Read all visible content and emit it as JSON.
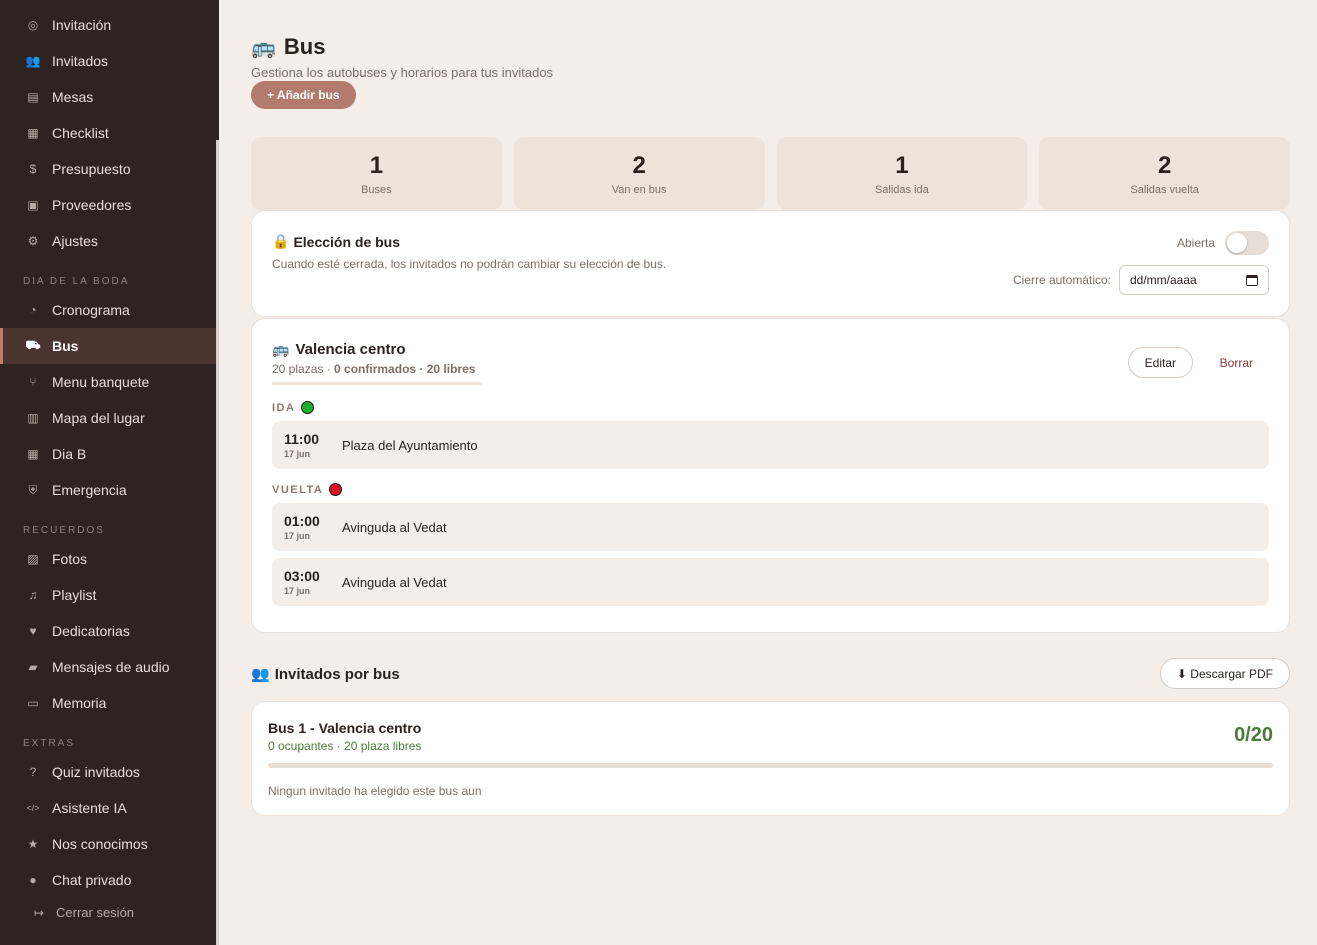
{
  "sidebar": {
    "items": [
      {
        "label": "Invitación",
        "icon": "globe-icon",
        "glyph": "◎"
      },
      {
        "label": "Invitados",
        "icon": "users-icon",
        "glyph": "👥"
      },
      {
        "label": "Mesas",
        "icon": "table-icon",
        "glyph": "▤"
      },
      {
        "label": "Checklist",
        "icon": "calendar-icon",
        "glyph": "▦"
      },
      {
        "label": "Presupuesto",
        "icon": "money-icon",
        "glyph": "$"
      },
      {
        "label": "Proveedores",
        "icon": "briefcase-icon",
        "glyph": "▣"
      },
      {
        "label": "Ajustes",
        "icon": "gear-icon",
        "glyph": "⚙"
      }
    ],
    "section_wedding": "DIA DE LA BODA",
    "wedding_items": [
      {
        "label": "Cronograma",
        "icon": "clock-icon",
        "glyph": "◔"
      },
      {
        "label": "Bus",
        "icon": "truck-icon",
        "glyph": "⛟"
      },
      {
        "label": "Menu banquete",
        "icon": "utensils-icon",
        "glyph": "⑂"
      },
      {
        "label": "Mapa del lugar",
        "icon": "map-icon",
        "glyph": "▥"
      },
      {
        "label": "Dia B",
        "icon": "calendar-icon",
        "glyph": "▦"
      },
      {
        "label": "Emergencia",
        "icon": "shield-icon",
        "glyph": "⛨"
      }
    ],
    "section_memories": "RECUERDOS",
    "memory_items": [
      {
        "label": "Fotos",
        "icon": "image-icon",
        "glyph": "▨"
      },
      {
        "label": "Playlist",
        "icon": "music-icon",
        "glyph": "♫"
      },
      {
        "label": "Dedicatorias",
        "icon": "heart-icon",
        "glyph": "♥"
      },
      {
        "label": "Mensajes de audio",
        "icon": "lock-icon",
        "glyph": "▰"
      },
      {
        "label": "Memoria",
        "icon": "book-icon",
        "glyph": "▭"
      }
    ],
    "section_extras": "EXTRAS",
    "extra_items": [
      {
        "label": "Quiz invitados",
        "icon": "question-icon",
        "glyph": "?"
      },
      {
        "label": "Asistente IA",
        "icon": "code-icon",
        "glyph": "</>"
      },
      {
        "label": "Nos conocimos",
        "icon": "star-icon",
        "glyph": "★"
      },
      {
        "label": "Chat privado",
        "icon": "chat-icon",
        "glyph": "●"
      }
    ],
    "logout": "Cerrar sesión"
  },
  "header": {
    "emoji": "🚌",
    "title": "Bus",
    "subtitle": "Gestiona los autobuses y horarios para tus invitados",
    "add_button": "+ Añadir bus"
  },
  "stats": [
    {
      "value": "1",
      "label": "Buses"
    },
    {
      "value": "2",
      "label": "Van en bus"
    },
    {
      "value": "1",
      "label": "Salidas ida"
    },
    {
      "value": "2",
      "label": "Salidas vuelta"
    }
  ],
  "election": {
    "emoji": "🔒",
    "title": "Elección de bus",
    "description": "Cuando esté cerrada, los invitados no podrán cambiar su elección de bus.",
    "toggle_label": "Abierta",
    "toggle_on": false,
    "auto_close_label": "Cierre automático:",
    "date_placeholder": "dd/mm/aaaa"
  },
  "bus": {
    "emoji": "🚌",
    "name": "Valencia centro",
    "seats": "20 plazas",
    "confirmed": "0 confirmados · 20 libres",
    "edit_label": "Editar",
    "delete_label": "Borrar",
    "ida_label": "IDA",
    "vuelta_label": "VUELTA",
    "ida": [
      {
        "time": "11:00",
        "date": "17 jun",
        "place": "Plaza del Ayuntamiento"
      }
    ],
    "vuelta": [
      {
        "time": "01:00",
        "date": "17 jun",
        "place": "Avinguda al Vedat"
      },
      {
        "time": "03:00",
        "date": "17 jun",
        "place": "Avinguda al Vedat"
      }
    ]
  },
  "guests": {
    "emoji": "👥",
    "title": "Invitados por bus",
    "pdf_button": "⬇ Descargar PDF",
    "card": {
      "title": "Bus 1 - Valencia centro",
      "meta": "0 ocupantes · 20 plaza libres",
      "count": "0/20",
      "occupancy": 0,
      "empty": "Ningun invitado ha elegido este bus aun"
    }
  },
  "colors": {
    "accent": "#b27b6e",
    "sidebar_bg": "#2e2321",
    "page_bg": "#f5ede7",
    "success": "#4c7a3b",
    "ida_dot": "#1db02a",
    "vuelta_dot": "#d4141e"
  }
}
